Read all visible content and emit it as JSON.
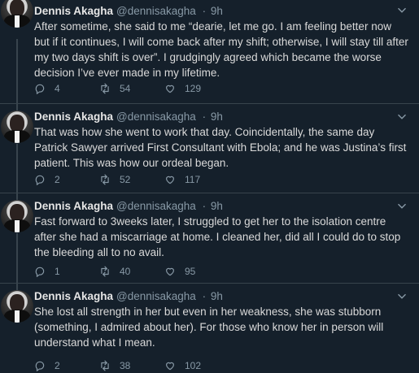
{
  "tweets": [
    {
      "name": "Dennis Akagha",
      "handle": "@dennisakagha",
      "time": "9h",
      "text": "After sometime, she said to me “dearie, let me go. I am feeling better now but if it continues, I will come back after my shift; otherwise, I will stay till after my two days shift is over”. I grudgingly agreed which became the worse decision I’ve ever made in my lifetime.",
      "replies": "4",
      "retweets": "54",
      "likes": "129"
    },
    {
      "name": "Dennis Akagha",
      "handle": "@dennisakagha",
      "time": "9h",
      "text": "That was how she went to work that day. Coincidentally, the same day Patrick Sawyer arrived First Consultant with Ebola; and he was Justina’s first patient.  This was how our ordeal began.",
      "replies": "2",
      "retweets": "52",
      "likes": "117"
    },
    {
      "name": "Dennis Akagha",
      "handle": "@dennisakagha",
      "time": "9h",
      "text": "Fast forward to 3weeks later, I struggled to get her to the isolation centre after she had a miscarriage at home. I cleaned her, did all I could do to stop the bleeding all to no avail.",
      "replies": "1",
      "retweets": "40",
      "likes": "95"
    },
    {
      "name": "Dennis Akagha",
      "handle": "@dennisakagha",
      "time": "9h",
      "text": "She lost all strength in her but even in her weakness, she was stubborn (something, I admired about her). For those who know her in person will understand what I mean.",
      "replies": "2",
      "retweets": "38",
      "likes": "102"
    }
  ],
  "meta_separator": "·",
  "icons": {
    "more": "chevron-down-icon",
    "reply": "reply-icon",
    "retweet": "retweet-icon",
    "like": "heart-icon"
  },
  "colors": {
    "background": "#15202b",
    "text": "#d9d9d9",
    "muted": "#8899a6",
    "divider": "#38444d"
  }
}
